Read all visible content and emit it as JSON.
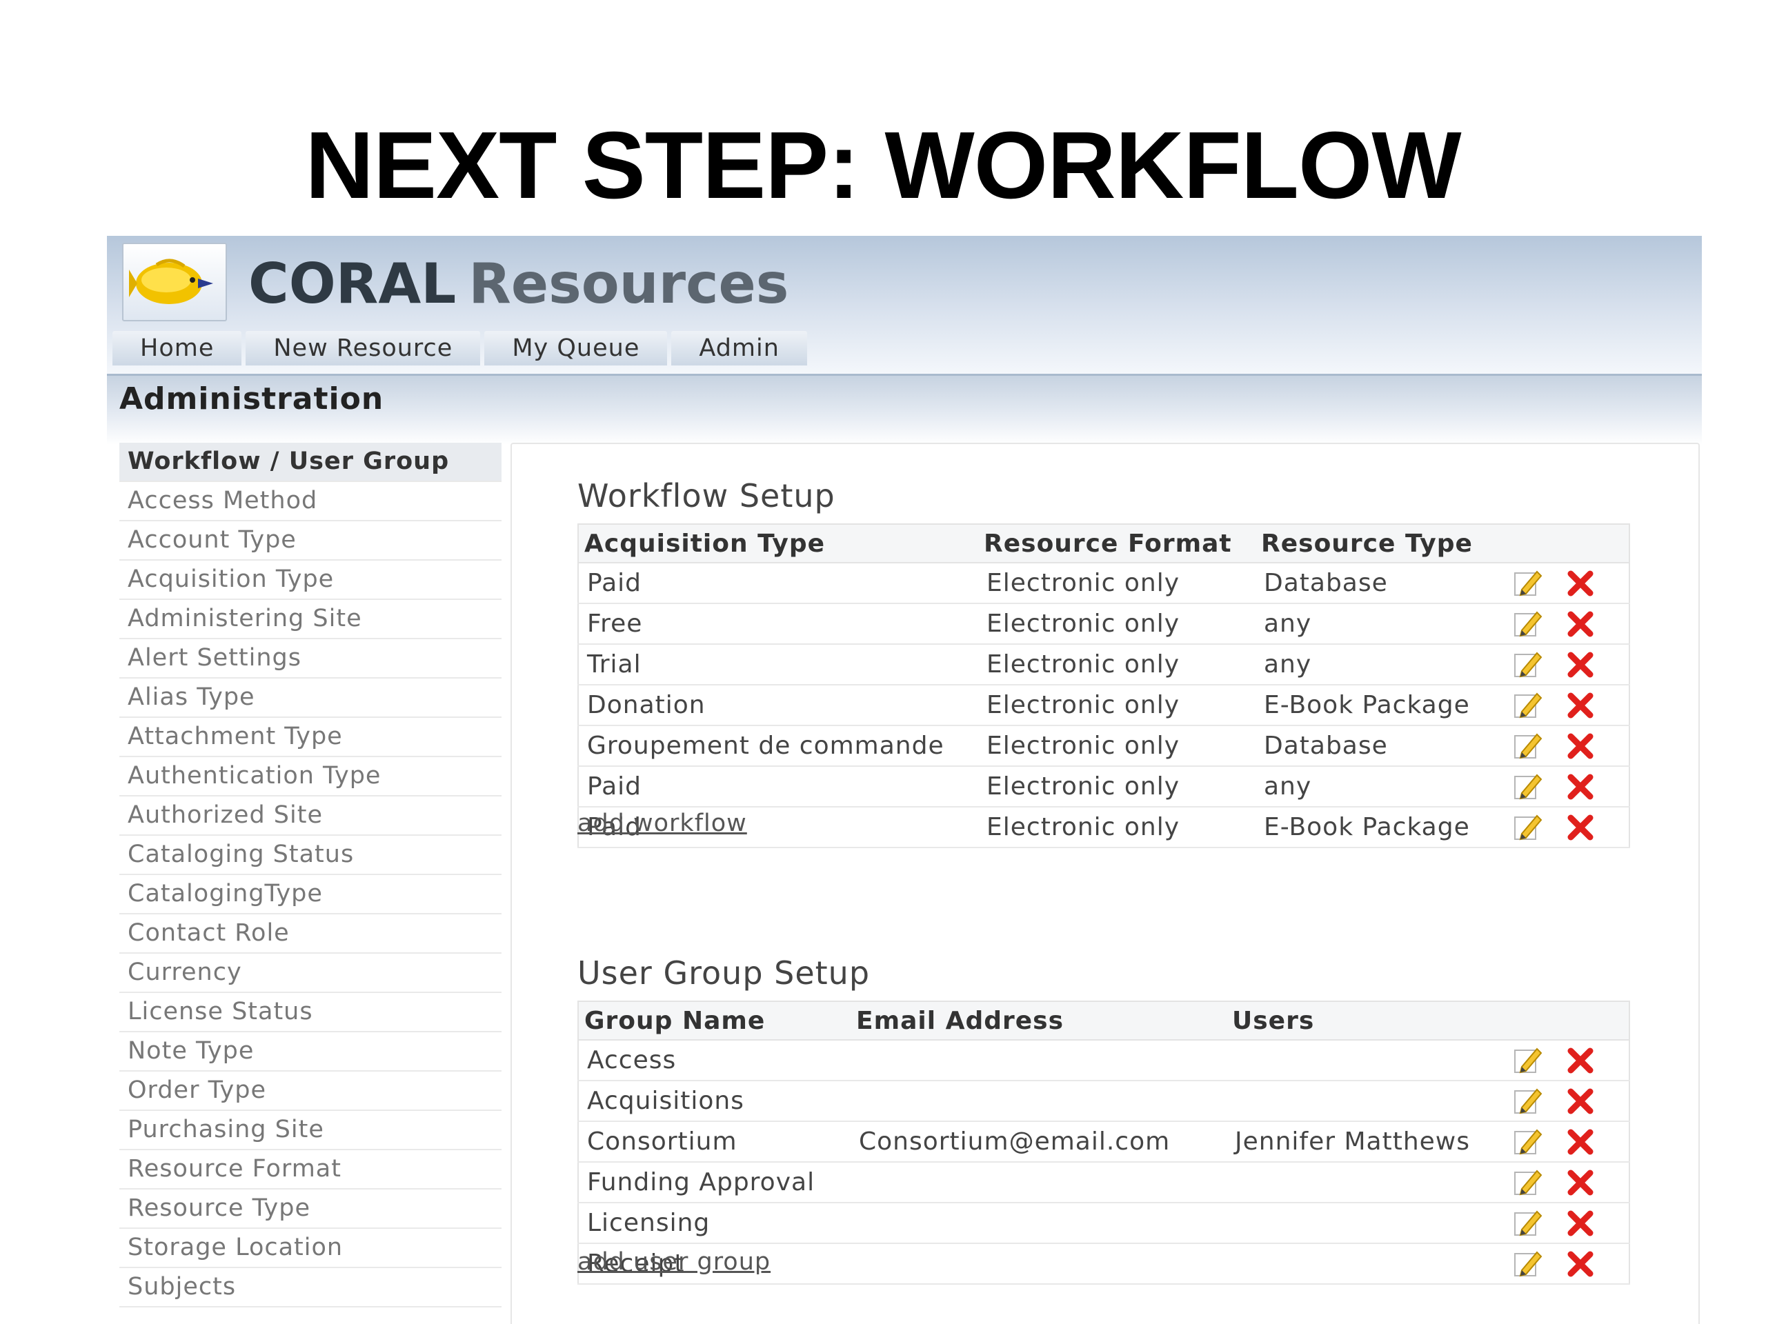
{
  "slide": {
    "title": "NEXT STEP: WORKFLOW"
  },
  "brand": {
    "part1": "CORAL",
    "part2": "Resources"
  },
  "nav": [
    {
      "label": "Home"
    },
    {
      "label": "New Resource"
    },
    {
      "label": "My Queue"
    },
    {
      "label": "Admin"
    }
  ],
  "admin": {
    "title": "Administration"
  },
  "sidebar": {
    "items": [
      {
        "label": "Workflow / User Group",
        "active": true
      },
      {
        "label": "Access Method"
      },
      {
        "label": "Account Type"
      },
      {
        "label": "Acquisition Type"
      },
      {
        "label": "Administering Site"
      },
      {
        "label": "Alert Settings"
      },
      {
        "label": "Alias Type"
      },
      {
        "label": "Attachment Type"
      },
      {
        "label": "Authentication Type"
      },
      {
        "label": "Authorized Site"
      },
      {
        "label": "Cataloging Status"
      },
      {
        "label": "CatalogingType"
      },
      {
        "label": "Contact Role"
      },
      {
        "label": "Currency"
      },
      {
        "label": "License Status"
      },
      {
        "label": "Note Type"
      },
      {
        "label": "Order Type"
      },
      {
        "label": "Purchasing Site"
      },
      {
        "label": "Resource Format"
      },
      {
        "label": "Resource Type"
      },
      {
        "label": "Storage Location"
      },
      {
        "label": "Subjects"
      }
    ]
  },
  "workflow": {
    "title": "Workflow Setup",
    "headers": [
      "Acquisition Type",
      "Resource Format",
      "Resource Type"
    ],
    "rows": [
      [
        "Paid",
        "Electronic only",
        "Database"
      ],
      [
        "Free",
        "Electronic only",
        "any"
      ],
      [
        "Trial",
        "Electronic only",
        "any"
      ],
      [
        "Donation",
        "Electronic only",
        "E-Book Package"
      ],
      [
        "Groupement de commande",
        "Electronic only",
        "Database"
      ],
      [
        "Paid",
        "Electronic only",
        "any"
      ],
      [
        "Paid",
        "Electronic only",
        "E-Book Package"
      ]
    ],
    "add_label": "add workflow"
  },
  "usergroup": {
    "title": "User Group Setup",
    "headers": [
      "Group Name",
      "Email Address",
      "Users"
    ],
    "rows": [
      [
        "Access",
        "",
        ""
      ],
      [
        "Acquisitions",
        "",
        ""
      ],
      [
        "Consortium",
        "Consortium@email.com",
        "Jennifer Matthews"
      ],
      [
        "Funding Approval",
        "",
        ""
      ],
      [
        "Licensing",
        "",
        ""
      ],
      [
        "Receipt",
        "",
        ""
      ]
    ],
    "add_label": "add user group"
  },
  "icons": {
    "edit": "pencil-edit-icon",
    "delete": "red-x-delete-icon",
    "logo": "yellow-fish-logo"
  }
}
